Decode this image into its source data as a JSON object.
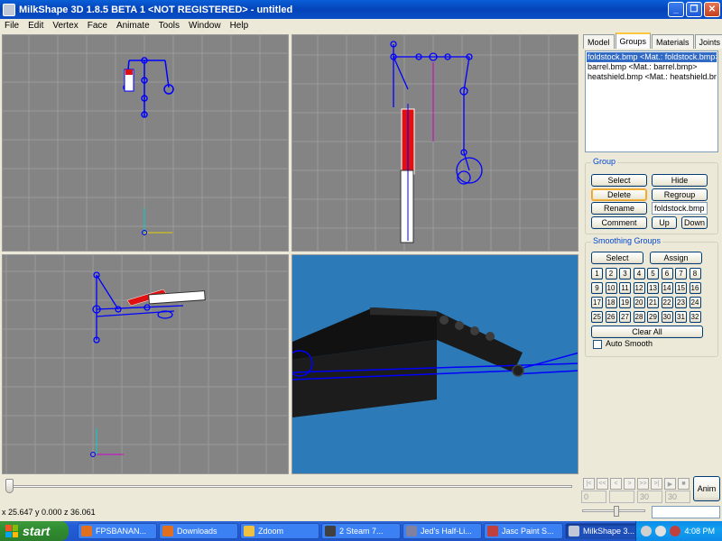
{
  "window": {
    "title": "MilkShape 3D 1.8.5 BETA 1 <NOT REGISTERED> - untitled",
    "minimize": "_",
    "maximize": "❐",
    "close": "✕"
  },
  "menu": [
    "File",
    "Edit",
    "Vertex",
    "Face",
    "Animate",
    "Tools",
    "Window",
    "Help"
  ],
  "tabs": [
    "Model",
    "Groups",
    "Materials",
    "Joints"
  ],
  "active_tab": "Groups",
  "groups_list": [
    "foldstock.bmp <Mat.: foldstock.bmp>",
    "barrel.bmp <Mat.: barrel.bmp>",
    "heatshield.bmp <Mat.: heatshield.bmp>"
  ],
  "group": {
    "title": "Group",
    "select": "Select",
    "hide": "Hide",
    "delete": "Delete",
    "regroup": "Regroup",
    "rename": "Rename",
    "name_value": "foldstock.bmp",
    "comment": "Comment",
    "up": "Up",
    "down": "Down"
  },
  "smoothing": {
    "title": "Smoothing Groups",
    "select": "Select",
    "assign": "Assign",
    "numbers": [
      "1",
      "2",
      "3",
      "4",
      "5",
      "6",
      "7",
      "8",
      "9",
      "10",
      "11",
      "12",
      "13",
      "14",
      "15",
      "16",
      "17",
      "18",
      "19",
      "20",
      "21",
      "22",
      "23",
      "24",
      "25",
      "26",
      "27",
      "28",
      "29",
      "30",
      "31",
      "32"
    ],
    "clear_all": "Clear All",
    "auto_smooth": "Auto Smooth",
    "auto_smooth_checked": false
  },
  "timeline": {
    "start_frame": "0",
    "frame_a": "30",
    "frame_b": "30",
    "anim_button": "Anim",
    "nav": [
      "|<",
      "<<",
      "<",
      ">",
      ">>",
      ">|"
    ]
  },
  "status": {
    "coords": "x 25.647 y 0.000 z 36.061"
  },
  "taskbar": {
    "start": "start",
    "items": [
      {
        "label": "FPSBANAN...",
        "color": "#e07020",
        "active": false
      },
      {
        "label": "Downloads",
        "color": "#e07020",
        "active": false
      },
      {
        "label": "Zdoom",
        "color": "#f0c040",
        "active": false
      },
      {
        "label": "2 Steam 7...",
        "color": "#404040",
        "active": false
      },
      {
        "label": "Jed's Half-Li...",
        "color": "#8080a0",
        "active": false
      },
      {
        "label": "Jasc Paint S...",
        "color": "#c04040",
        "active": false
      },
      {
        "label": "MilkShape 3...",
        "color": "#c0c8d8",
        "active": true
      }
    ],
    "clock": "4:08 PM"
  },
  "colors": {
    "viewport_bg": "#848484",
    "grid_line": "#9a9a9a",
    "skeleton": "#0000ff",
    "selected_group": "#e01010",
    "viewport_3d_bg": "#2c7bb8"
  }
}
